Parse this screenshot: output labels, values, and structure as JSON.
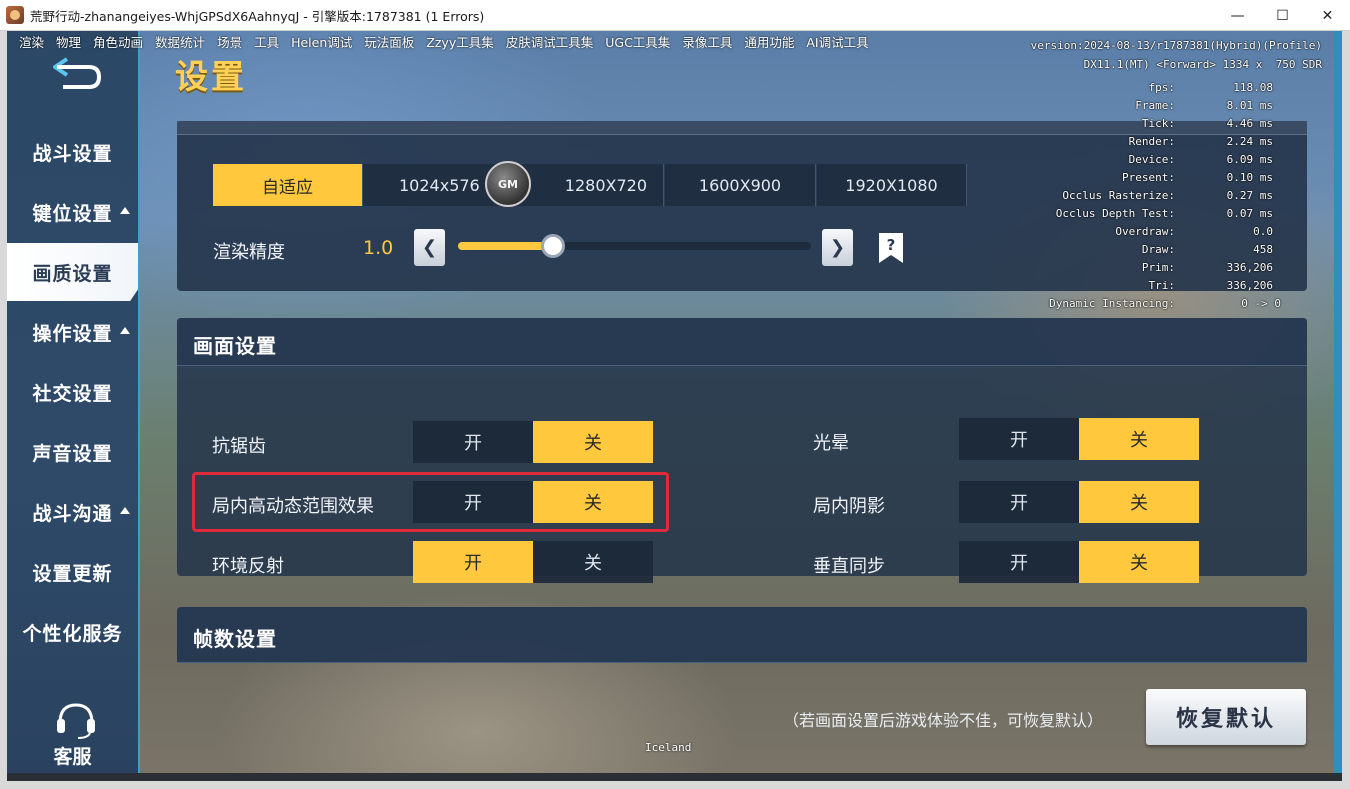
{
  "window": {
    "title": "荒野行动-zhanangeiyes-WhjGPSdX6AahnyqJ - 引擎版本:1787381 (1 Errors)",
    "controls": [
      "—",
      "☐",
      "✕"
    ]
  },
  "menubar": [
    "渲染",
    "物理",
    "角色动画",
    "数据统计",
    "场景",
    "工具",
    "Helen调试",
    "玩法面板",
    "Zzyy工具集",
    "皮肤调试工具集",
    "UGC工具集",
    "录像工具",
    "通用功能",
    "AI调试工具"
  ],
  "stats": {
    "version": "version:2024-08-13/r1787381(Hybrid)(Profile)",
    "renderer": "DX11.1(MT) <Forward> 1334 x  750 SDR",
    "rows": [
      {
        "k": "fps:",
        "v": "118.08"
      },
      {
        "k": "Frame:",
        "v": "8.01 ms"
      },
      {
        "k": "Tick:",
        "v": "4.46 ms"
      },
      {
        "k": "Render:",
        "v": "2.24 ms"
      },
      {
        "k": "Device:",
        "v": "6.09 ms"
      },
      {
        "k": "Present:",
        "v": "0.10 ms"
      },
      {
        "k": "Occlus Rasterize:",
        "v": "0.27 ms"
      },
      {
        "k": "Occlus Depth Test:",
        "v": "0.07 ms"
      },
      {
        "k": "Overdraw:",
        "v": "0.0"
      },
      {
        "k": "Draw:",
        "v": "458"
      },
      {
        "k": "Prim:",
        "v": "336,206"
      },
      {
        "k": "Tri:",
        "v": "336,206"
      },
      {
        "k": "Dynamic Instancing:",
        "v": "0 -> 0"
      }
    ]
  },
  "sidebar": {
    "items": [
      {
        "label": "战斗设置",
        "caret": false,
        "active": false
      },
      {
        "label": "键位设置",
        "caret": true,
        "active": false
      },
      {
        "label": "画质设置",
        "caret": false,
        "active": true
      },
      {
        "label": "操作设置",
        "caret": true,
        "active": false
      },
      {
        "label": "社交设置",
        "caret": false,
        "active": false
      },
      {
        "label": "声音设置",
        "caret": false,
        "active": false
      },
      {
        "label": "战斗沟通",
        "caret": true,
        "active": false
      },
      {
        "label": "设置更新",
        "caret": false,
        "active": false
      },
      {
        "label": "个性化服务",
        "caret": false,
        "active": false
      }
    ],
    "customer_service": "客服",
    "back_icon": "back-arrow-icon"
  },
  "page_title": "设置",
  "resolution": {
    "options": [
      "自适应",
      "1024x576",
      "1280X720",
      "1600X900",
      "1920X1080"
    ],
    "selected": "自适应",
    "gm_badge": "GM",
    "render_label": "渲染精度",
    "render_value": "1.0",
    "render_level": 0.27,
    "prev_icon": "chevron-left-icon",
    "next_icon": "chevron-right-icon",
    "help_icon": "question-bookmark-icon"
  },
  "picture": {
    "header": "画面设置",
    "on_label": "开",
    "off_label": "关",
    "options": [
      {
        "label": "抗锯齿",
        "value": "关"
      },
      {
        "label": "光晕",
        "value": "关"
      },
      {
        "label": "局内高动态范围效果",
        "value": "关",
        "highlighted": true
      },
      {
        "label": "局内阴影",
        "value": "关"
      },
      {
        "label": "环境反射",
        "value": "开"
      },
      {
        "label": "垂直同步",
        "value": "关"
      }
    ]
  },
  "fps_section": {
    "header": "帧数设置"
  },
  "footer": {
    "hint": "（若画面设置后游戏体验不佳，可恢复默认）",
    "restore_button": "恢复默认",
    "map_name": "Iceland"
  },
  "colors": {
    "accent": "#ffc83d",
    "highlight": "#e0293a",
    "panel": "#24344a",
    "sidebar": "#2c4867"
  }
}
